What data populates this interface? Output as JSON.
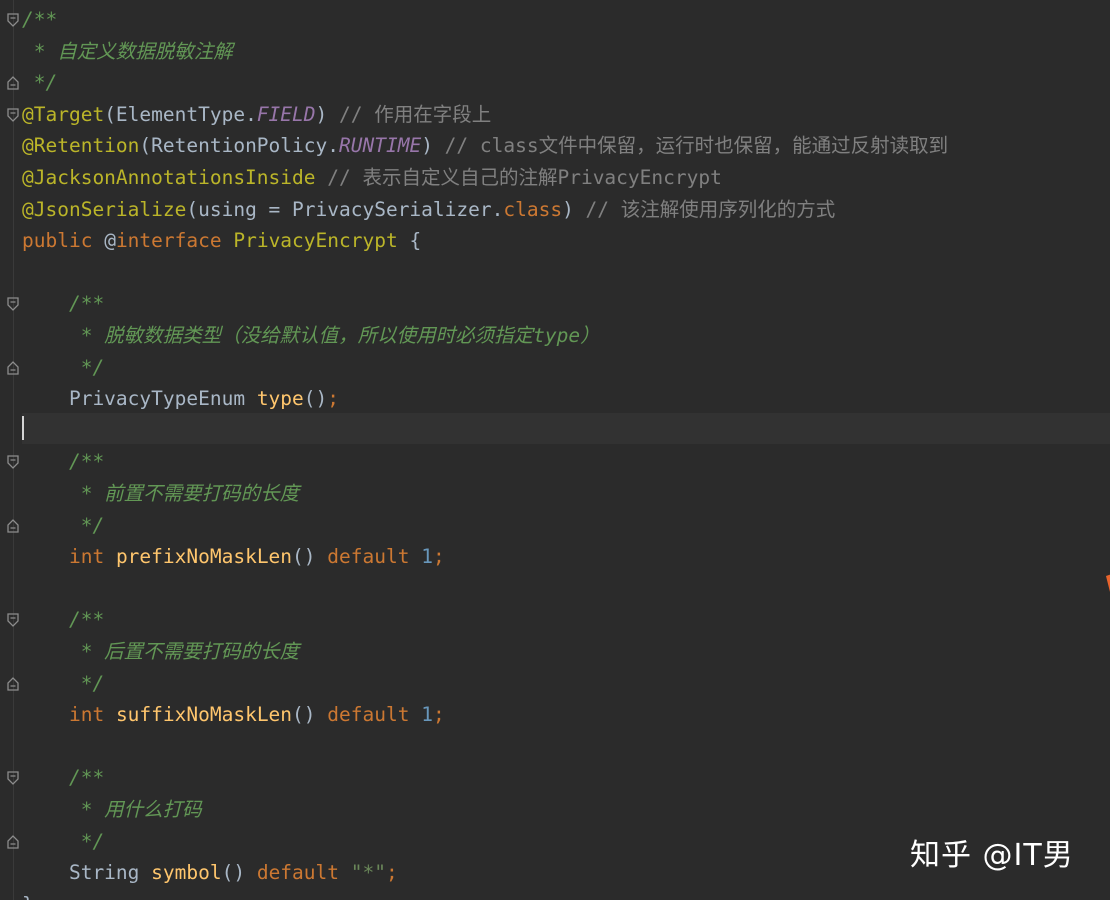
{
  "editor": {
    "lines": [
      [
        {
          "t": "/**",
          "s": "doc"
        }
      ],
      [
        {
          "t": " * 自定义数据脱敏注解",
          "s": "doc"
        }
      ],
      [
        {
          "t": " */",
          "s": "doc"
        }
      ],
      [
        {
          "t": "@Target",
          "s": "ann"
        },
        {
          "t": "(ElementType.",
          "s": "plain"
        },
        {
          "t": "FIELD",
          "s": "fld"
        },
        {
          "t": ") ",
          "s": "plain"
        },
        {
          "t": "// 作用在字段上",
          "s": "cmt"
        }
      ],
      [
        {
          "t": "@Retention",
          "s": "ann"
        },
        {
          "t": "(RetentionPolicy.",
          "s": "plain"
        },
        {
          "t": "RUNTIME",
          "s": "fld"
        },
        {
          "t": ") ",
          "s": "plain"
        },
        {
          "t": "// class文件中保留，运行时也保留，能通过反射读取到",
          "s": "cmt"
        }
      ],
      [
        {
          "t": "@JacksonAnnotationsInside",
          "s": "ann"
        },
        {
          "t": " ",
          "s": "plain"
        },
        {
          "t": "// 表示自定义自己的注解PrivacyEncrypt",
          "s": "cmt"
        }
      ],
      [
        {
          "t": "@JsonSerialize",
          "s": "ann"
        },
        {
          "t": "(using = PrivacySerializer.",
          "s": "plain"
        },
        {
          "t": "class",
          "s": "kw"
        },
        {
          "t": ") ",
          "s": "plain"
        },
        {
          "t": "// 该注解使用序列化的方式",
          "s": "cmt"
        }
      ],
      [
        {
          "t": "public ",
          "s": "kw"
        },
        {
          "t": "@",
          "s": "plain"
        },
        {
          "t": "interface ",
          "s": "kw"
        },
        {
          "t": "PrivacyEncrypt",
          "s": "ann"
        },
        {
          "t": " {",
          "s": "plain"
        }
      ],
      [],
      [
        {
          "t": "    /**",
          "s": "doc"
        }
      ],
      [
        {
          "t": "     * 脱敏数据类型（没给默认值，所以使用时必须指定type）",
          "s": "doc"
        }
      ],
      [
        {
          "t": "     */",
          "s": "doc"
        }
      ],
      [
        {
          "t": "    PrivacyTypeEnum ",
          "s": "plain"
        },
        {
          "t": "type",
          "s": "meth"
        },
        {
          "t": "()",
          "s": "plain"
        },
        {
          "t": ";",
          "s": "kw"
        }
      ],
      [],
      [
        {
          "t": "    /**",
          "s": "doc"
        }
      ],
      [
        {
          "t": "     * 前置不需要打码的长度",
          "s": "doc"
        }
      ],
      [
        {
          "t": "     */",
          "s": "doc"
        }
      ],
      [
        {
          "t": "    ",
          "s": "plain"
        },
        {
          "t": "int ",
          "s": "kw"
        },
        {
          "t": "prefixNoMaskLen",
          "s": "meth"
        },
        {
          "t": "() ",
          "s": "plain"
        },
        {
          "t": "default ",
          "s": "kw"
        },
        {
          "t": "1",
          "s": "num"
        },
        {
          "t": ";",
          "s": "kw"
        }
      ],
      [],
      [
        {
          "t": "    /**",
          "s": "doc"
        }
      ],
      [
        {
          "t": "     * 后置不需要打码的长度",
          "s": "doc"
        }
      ],
      [
        {
          "t": "     */",
          "s": "doc"
        }
      ],
      [
        {
          "t": "    ",
          "s": "plain"
        },
        {
          "t": "int ",
          "s": "kw"
        },
        {
          "t": "suffixNoMaskLen",
          "s": "meth"
        },
        {
          "t": "() ",
          "s": "plain"
        },
        {
          "t": "default ",
          "s": "kw"
        },
        {
          "t": "1",
          "s": "num"
        },
        {
          "t": ";",
          "s": "kw"
        }
      ],
      [],
      [
        {
          "t": "    /**",
          "s": "doc"
        }
      ],
      [
        {
          "t": "     * 用什么打码",
          "s": "doc"
        }
      ],
      [
        {
          "t": "     */",
          "s": "doc"
        }
      ],
      [
        {
          "t": "    String ",
          "s": "plain"
        },
        {
          "t": "symbol",
          "s": "meth"
        },
        {
          "t": "() ",
          "s": "plain"
        },
        {
          "t": "default ",
          "s": "kw"
        },
        {
          "t": "\"*\"",
          "s": "str"
        },
        {
          "t": ";",
          "s": "kw"
        }
      ],
      [
        {
          "t": "}",
          "s": "plain"
        }
      ]
    ],
    "fold_markers": [
      {
        "line": 0,
        "kind": "open"
      },
      {
        "line": 2,
        "kind": "close"
      },
      {
        "line": 3,
        "kind": "open"
      },
      {
        "line": 9,
        "kind": "open"
      },
      {
        "line": 11,
        "kind": "close"
      },
      {
        "line": 14,
        "kind": "open"
      },
      {
        "line": 16,
        "kind": "close"
      },
      {
        "line": 19,
        "kind": "open"
      },
      {
        "line": 21,
        "kind": "close"
      },
      {
        "line": 24,
        "kind": "open"
      },
      {
        "line": 26,
        "kind": "close"
      }
    ],
    "current_line": 13
  },
  "watermark": {
    "text": "知乎 @IT男"
  },
  "colors": {
    "background": "#2b2b2b",
    "doc_comment": "#629755",
    "line_comment": "#808080",
    "annotation": "#bbb529",
    "keyword": "#cc7832",
    "static_field": "#9876aa",
    "method": "#ffc66d",
    "number": "#6897bb",
    "string": "#6a8759",
    "plain": "#a9b7c6"
  }
}
